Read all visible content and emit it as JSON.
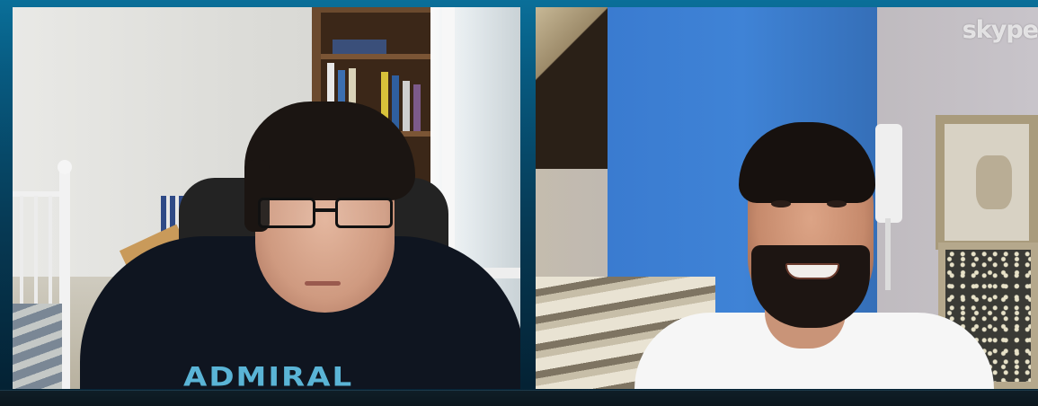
{
  "app": {
    "watermark": "skype",
    "accent_color": "#0a6f99",
    "bar_color": "#0f1e27"
  },
  "feeds": [
    {
      "name": "remote-participant-left",
      "shirt_text": "ADMIRAL"
    },
    {
      "name": "remote-participant-right"
    }
  ]
}
